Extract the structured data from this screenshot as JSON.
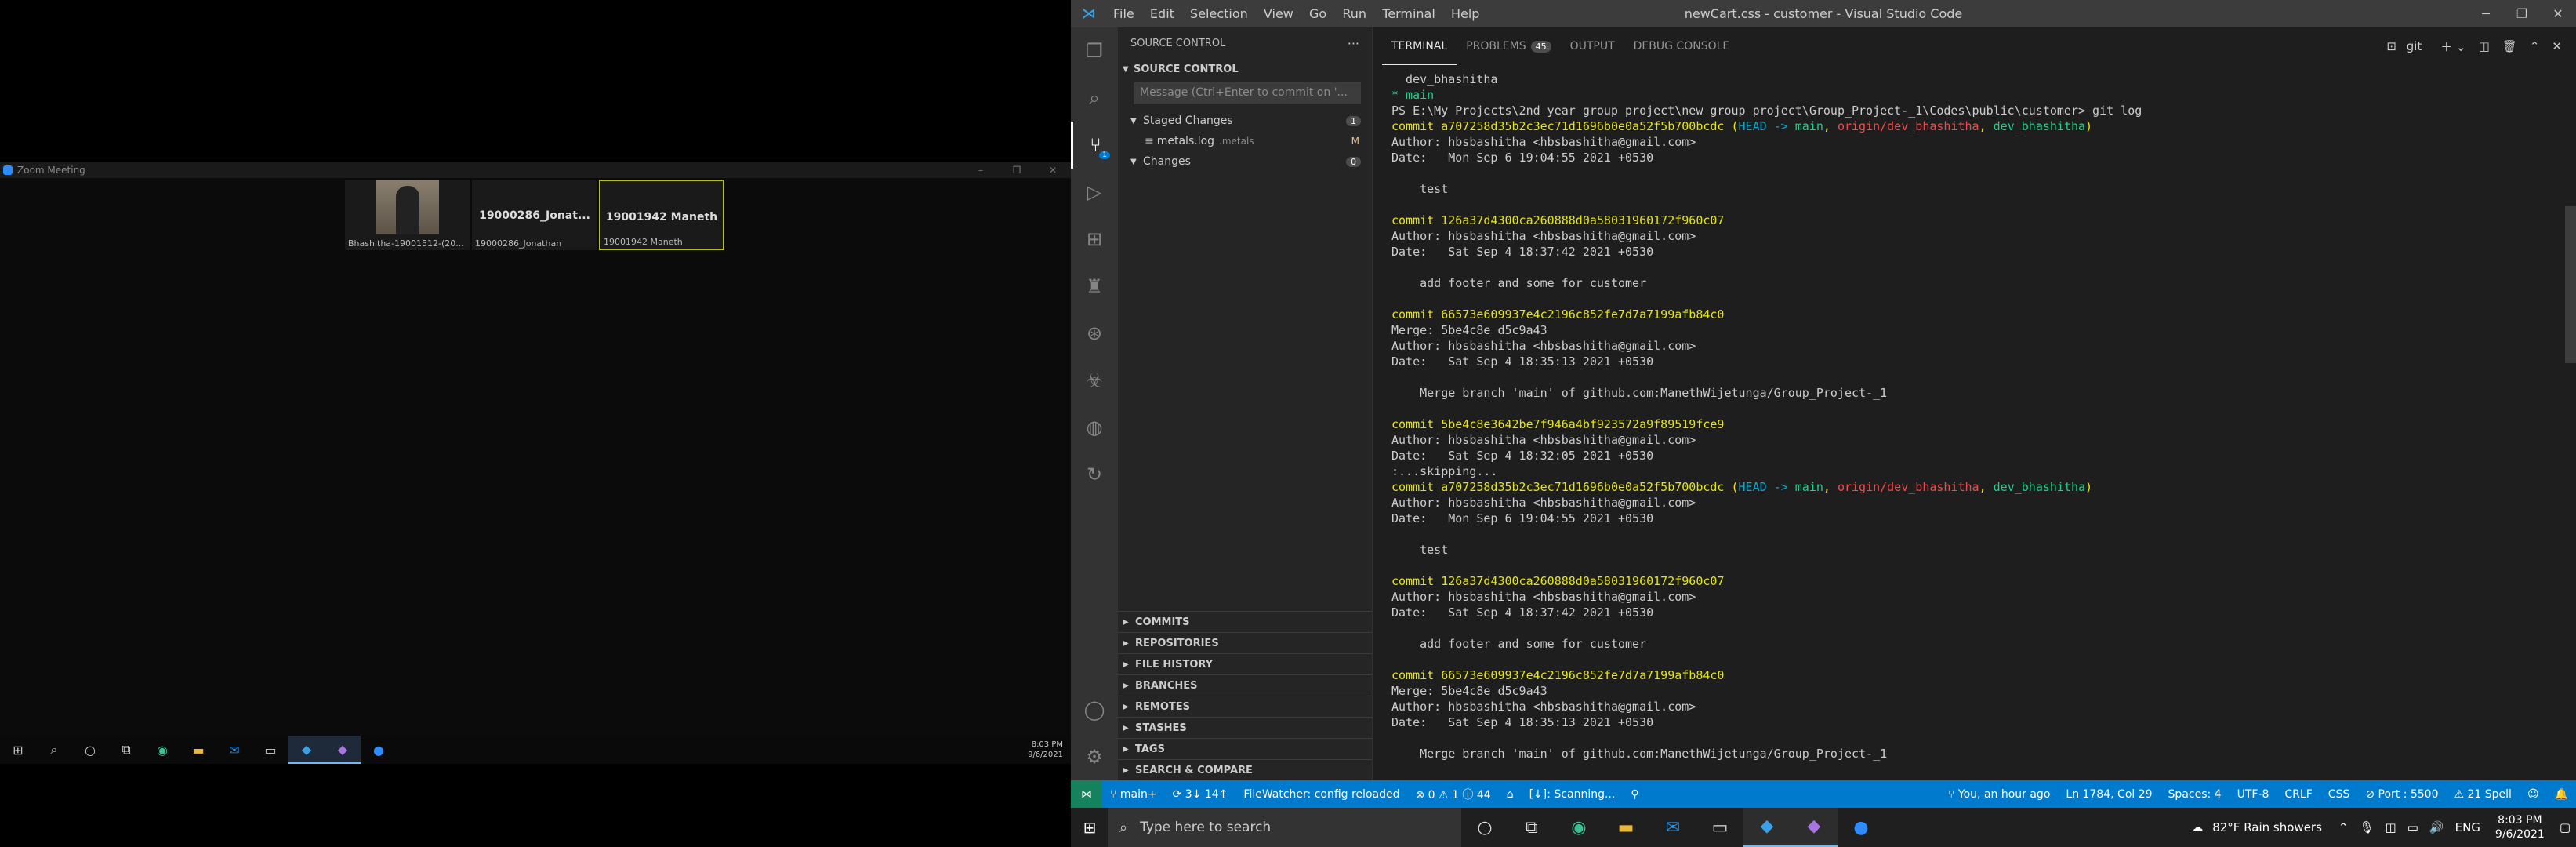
{
  "zoom": {
    "title": "Zoom Meeting",
    "controls": [
      "–",
      "❐",
      "✕"
    ],
    "tiles": [
      {
        "name": "",
        "caption": "Bhashitha-19001512-(20..."
      },
      {
        "name": "19000286_Jonat...",
        "caption": "19000286_Jonathan"
      },
      {
        "name": "19001942 Maneth",
        "caption": "19001942 Maneth"
      }
    ]
  },
  "left_taskbar": {
    "time": "8:03 PM",
    "date": "9/6/2021",
    "icons": [
      "windows-icon",
      "search-icon",
      "cortana-icon",
      "task-view-icon",
      "edge-icon",
      "explorer-icon",
      "mail-icon",
      "terminal-icon",
      "vscode-icon",
      "vs-icon",
      "zoom-icon"
    ]
  },
  "vscode": {
    "window_title": "newCart.css - customer - Visual Studio Code",
    "menu": [
      "File",
      "Edit",
      "Selection",
      "View",
      "Go",
      "Run",
      "Terminal",
      "Help"
    ],
    "activity_badge": "1",
    "sidebar": {
      "header": "SOURCE CONTROL",
      "section": "SOURCE CONTROL",
      "commit_placeholder": "Message (Ctrl+Enter to commit on '...",
      "staged_label": "Staged Changes",
      "staged_count": "1",
      "file_name": "metals.log",
      "file_dir": ".metals",
      "file_status": "M",
      "changes_label": "Changes",
      "changes_count": "0",
      "gitlens_panels": [
        "COMMITS",
        "REPOSITORIES",
        "FILE HISTORY",
        "BRANCHES",
        "REMOTES",
        "STASHES",
        "TAGS",
        "SEARCH & COMPARE"
      ]
    },
    "panel": {
      "tabs": [
        {
          "label": "TERMINAL"
        },
        {
          "label": "PROBLEMS",
          "count": "45"
        },
        {
          "label": "OUTPUT"
        },
        {
          "label": "DEBUG CONSOLE"
        }
      ],
      "terminal_shell": "git"
    },
    "terminal_lines": [
      [
        {
          "t": "  dev_bhashitha",
          "c": "white"
        }
      ],
      [
        {
          "t": "* main",
          "c": "green"
        }
      ],
      [
        {
          "t": "PS E:\\My Projects\\2nd year group project\\new group project\\Group_Project-_1\\Codes\\public\\customer> git log",
          "c": "white"
        }
      ],
      [
        {
          "t": "commit a707258d35b2c3ec71d1696b0e0a52f5b700bcdc",
          "c": "yellow"
        },
        {
          "t": " (",
          "c": "yellow"
        },
        {
          "t": "HEAD -> ",
          "c": "cyan"
        },
        {
          "t": "main",
          "c": "green"
        },
        {
          "t": ", ",
          "c": "yellow"
        },
        {
          "t": "origin/dev_bhashitha",
          "c": "red"
        },
        {
          "t": ", ",
          "c": "yellow"
        },
        {
          "t": "dev_bhashitha",
          "c": "green"
        },
        {
          "t": ")",
          "c": "yellow"
        }
      ],
      [
        {
          "t": "Author: hbsbashitha <hbsbashitha@gmail.com>",
          "c": "white"
        }
      ],
      [
        {
          "t": "Date:   Mon Sep 6 19:04:55 2021 +0530",
          "c": "white"
        }
      ],
      [
        {
          "t": "",
          "c": "white"
        }
      ],
      [
        {
          "t": "    test",
          "c": "white"
        }
      ],
      [
        {
          "t": "",
          "c": "white"
        }
      ],
      [
        {
          "t": "commit 126a37d4300ca260888d0a58031960172f960c07",
          "c": "yellow"
        }
      ],
      [
        {
          "t": "Author: hbsbashitha <hbsbashitha@gmail.com>",
          "c": "white"
        }
      ],
      [
        {
          "t": "Date:   Sat Sep 4 18:37:42 2021 +0530",
          "c": "white"
        }
      ],
      [
        {
          "t": "",
          "c": "white"
        }
      ],
      [
        {
          "t": "    add footer and some for customer",
          "c": "white"
        }
      ],
      [
        {
          "t": "",
          "c": "white"
        }
      ],
      [
        {
          "t": "commit 66573e609937e4c2196c852fe7d7a7199afb84c0",
          "c": "yellow"
        }
      ],
      [
        {
          "t": "Merge: 5be4c8e d5c9a43",
          "c": "white"
        }
      ],
      [
        {
          "t": "Author: hbsbashitha <hbsbashitha@gmail.com>",
          "c": "white"
        }
      ],
      [
        {
          "t": "Date:   Sat Sep 4 18:35:13 2021 +0530",
          "c": "white"
        }
      ],
      [
        {
          "t": "",
          "c": "white"
        }
      ],
      [
        {
          "t": "    Merge branch 'main' of github.com:ManethWijetunga/Group_Project-_1",
          "c": "white"
        }
      ],
      [
        {
          "t": "",
          "c": "white"
        }
      ],
      [
        {
          "t": "commit 5be4c8e3642be7f946a4bf923572a9f89519fce9",
          "c": "yellow"
        }
      ],
      [
        {
          "t": "Author: hbsbashitha <hbsbashitha@gmail.com>",
          "c": "white"
        }
      ],
      [
        {
          "t": "Date:   Sat Sep 4 18:32:05 2021 +0530",
          "c": "white"
        }
      ],
      [
        {
          "t": ":...skipping...",
          "c": "white"
        }
      ],
      [
        {
          "t": "commit a707258d35b2c3ec71d1696b0e0a52f5b700bcdc",
          "c": "yellow"
        },
        {
          "t": " (",
          "c": "yellow"
        },
        {
          "t": "HEAD -> ",
          "c": "cyan"
        },
        {
          "t": "main",
          "c": "green"
        },
        {
          "t": ", ",
          "c": "yellow"
        },
        {
          "t": "origin/dev_bhashitha",
          "c": "red"
        },
        {
          "t": ", ",
          "c": "yellow"
        },
        {
          "t": "dev_bhashitha",
          "c": "green"
        },
        {
          "t": ")",
          "c": "yellow"
        }
      ],
      [
        {
          "t": "Author: hbsbashitha <hbsbashitha@gmail.com>",
          "c": "white"
        }
      ],
      [
        {
          "t": "Date:   Mon Sep 6 19:04:55 2021 +0530",
          "c": "white"
        }
      ],
      [
        {
          "t": "",
          "c": "white"
        }
      ],
      [
        {
          "t": "    test",
          "c": "white"
        }
      ],
      [
        {
          "t": "",
          "c": "white"
        }
      ],
      [
        {
          "t": "commit 126a37d4300ca260888d0a58031960172f960c07",
          "c": "yellow"
        }
      ],
      [
        {
          "t": "Author: hbsbashitha <hbsbashitha@gmail.com>",
          "c": "white"
        }
      ],
      [
        {
          "t": "Date:   Sat Sep 4 18:37:42 2021 +0530",
          "c": "white"
        }
      ],
      [
        {
          "t": "",
          "c": "white"
        }
      ],
      [
        {
          "t": "    add footer and some for customer",
          "c": "white"
        }
      ],
      [
        {
          "t": "",
          "c": "white"
        }
      ],
      [
        {
          "t": "commit 66573e609937e4c2196c852fe7d7a7199afb84c0",
          "c": "yellow"
        }
      ],
      [
        {
          "t": "Merge: 5be4c8e d5c9a43",
          "c": "white"
        }
      ],
      [
        {
          "t": "Author: hbsbashitha <hbsbashitha@gmail.com>",
          "c": "white"
        }
      ],
      [
        {
          "t": "Date:   Sat Sep 4 18:35:13 2021 +0530",
          "c": "white"
        }
      ],
      [
        {
          "t": "",
          "c": "white"
        }
      ],
      [
        {
          "t": "    Merge branch 'main' of github.com:ManethWijetunga/Group_Project-_1",
          "c": "white"
        }
      ]
    ],
    "colors": {
      "yellow": "#e5e510",
      "cyan": "#11a8cd",
      "green": "#23d18b",
      "red": "#f14c4c",
      "white": "#cccccc",
      "status_blue": "#007acc"
    },
    "statusbar": {
      "branch": "main+",
      "sync": "3↓ 14↑",
      "filewatcher": "FileWatcher: config reloaded",
      "errors": "0",
      "warnings": "1",
      "infos": "44",
      "scanning": "[↓]: Scanning...",
      "blame": "You, an hour ago",
      "position": "Ln 1784, Col 29",
      "spaces": "Spaces: 4",
      "encoding": "UTF-8",
      "eol": "CRLF",
      "language": "CSS",
      "port": "Port : 5500",
      "spell": "21 Spell"
    }
  },
  "taskbar": {
    "search_placeholder": "Type here to search",
    "weather": "82°F  Rain showers",
    "lang": "ENG",
    "time": "8:03 PM",
    "date": "9/6/2021"
  }
}
